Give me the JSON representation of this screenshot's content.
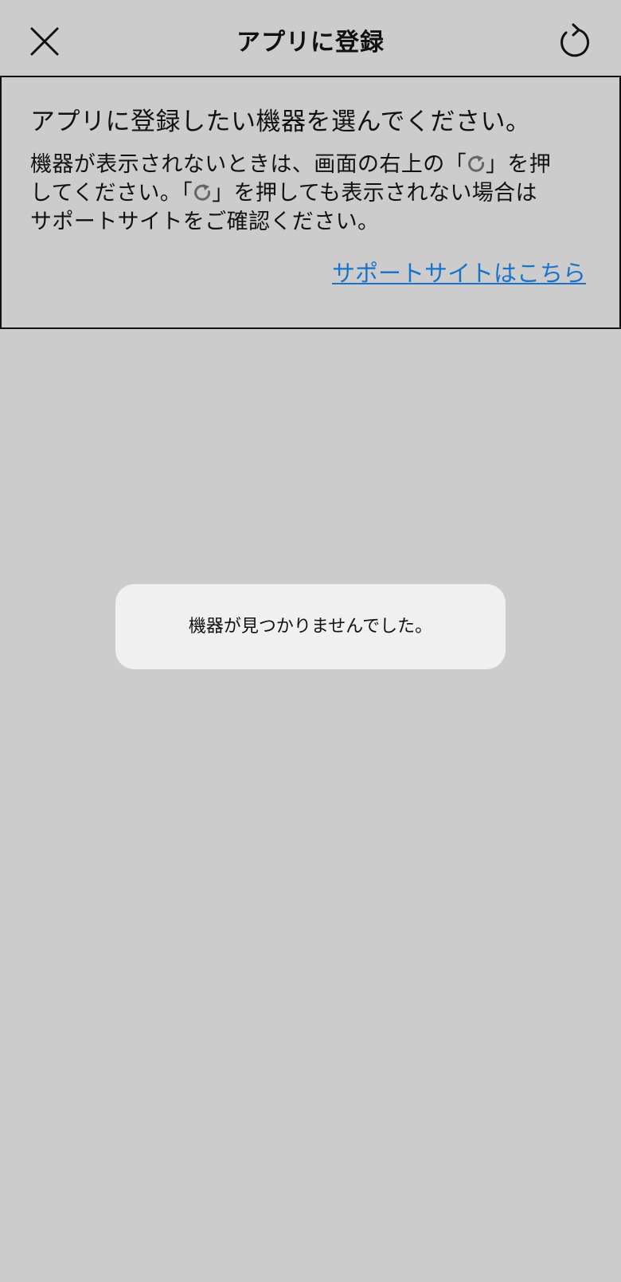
{
  "header": {
    "title": "アプリに登録",
    "close_icon": "close-icon",
    "refresh_icon": "refresh-icon"
  },
  "panel": {
    "heading": "アプリに登録したい機器を選んでください。",
    "desc_line1_pre": "機器が表示されないときは、画面の右上の「",
    "desc_line1_post": "」を押",
    "desc_line2_pre": "してください。「",
    "desc_line2_post": "」を押しても表示されない場合は",
    "desc_line3": "サポートサイトをご確認ください。",
    "support_link": "サポートサイトはこちら",
    "link_color": "#1a73c8"
  },
  "toast": {
    "message": "機器が見つかりませんでした。"
  }
}
